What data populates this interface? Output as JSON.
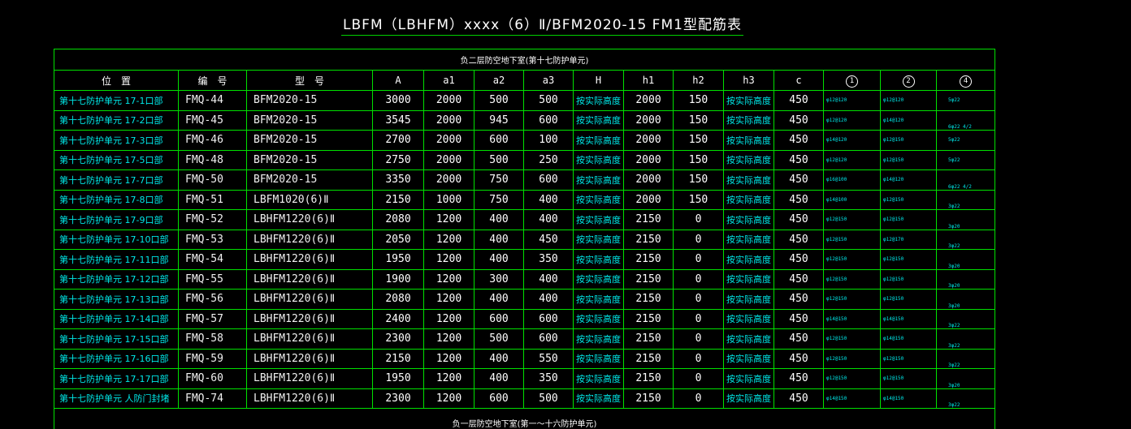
{
  "title": "LBFM（LBHFM）xxxx（6）Ⅱ/BFM2020-15 FM1型配筋表",
  "section_top": "负二层防空地下室(第十七防护单元)",
  "section_bottom": "负一层防空地下室(第一～十六防护单元)",
  "headers": [
    "位　置",
    "编　号",
    "型　号",
    "A",
    "a1",
    "a2",
    "a3",
    "H",
    "h1",
    "h2",
    "h3",
    "c",
    "1",
    "2",
    "4"
  ],
  "rows": [
    {
      "pos": "第十七防护单元 17-1口部",
      "code": "FMQ-44",
      "model": "BFM2020-15",
      "A": "3000",
      "a1": "2000",
      "a2": "500",
      "a3": "500",
      "H": "按实际高度",
      "h1": "2000",
      "h2": "150",
      "h3": "按实际高度",
      "c": "450",
      "r1": "φ12@120",
      "r2": "φ12@120",
      "r4": "5φ22",
      "r4low": false
    },
    {
      "pos": "第十七防护单元 17-2口部",
      "code": "FMQ-45",
      "model": "BFM2020-15",
      "A": "3545",
      "a1": "2000",
      "a2": "945",
      "a3": "600",
      "H": "按实际高度",
      "h1": "2000",
      "h2": "150",
      "h3": "按实际高度",
      "c": "450",
      "r1": "φ12@120",
      "r2": "φ14@120",
      "r4": "6φ22 4/2",
      "r4low": true
    },
    {
      "pos": "第十七防护单元 17-3口部",
      "code": "FMQ-46",
      "model": "BFM2020-15",
      "A": "2700",
      "a1": "2000",
      "a2": "600",
      "a3": "100",
      "H": "按实际高度",
      "h1": "2000",
      "h2": "150",
      "h3": "按实际高度",
      "c": "450",
      "r1": "φ14@120",
      "r2": "φ12@150",
      "r4": "5φ22",
      "r4low": false
    },
    {
      "pos": "第十七防护单元 17-5口部",
      "code": "FMQ-48",
      "model": "BFM2020-15",
      "A": "2750",
      "a1": "2000",
      "a2": "500",
      "a3": "250",
      "H": "按实际高度",
      "h1": "2000",
      "h2": "150",
      "h3": "按实际高度",
      "c": "450",
      "r1": "φ12@120",
      "r2": "φ12@150",
      "r4": "5φ22",
      "r4low": false
    },
    {
      "pos": "第十七防护单元 17-7口部",
      "code": "FMQ-50",
      "model": "BFM2020-15",
      "A": "3350",
      "a1": "2000",
      "a2": "750",
      "a3": "600",
      "H": "按实际高度",
      "h1": "2000",
      "h2": "150",
      "h3": "按实际高度",
      "c": "450",
      "r1": "φ16@100",
      "r2": "φ14@120",
      "r4": "6φ22 4/2",
      "r4low": true
    },
    {
      "pos": "第十七防护单元 17-8口部",
      "code": "FMQ-51",
      "model": "LBFM1020(6)Ⅱ",
      "A": "2150",
      "a1": "1000",
      "a2": "750",
      "a3": "400",
      "H": "按实际高度",
      "h1": "2000",
      "h2": "150",
      "h3": "按实际高度",
      "c": "450",
      "r1": "φ14@100",
      "r2": "φ12@150",
      "r4": "3φ22",
      "r4low": true
    },
    {
      "pos": "第十七防护单元 17-9口部",
      "code": "FMQ-52",
      "model": "LBHFM1220(6)Ⅱ",
      "A": "2080",
      "a1": "1200",
      "a2": "400",
      "a3": "400",
      "H": "按实际高度",
      "h1": "2150",
      "h2": "0",
      "h3": "按实际高度",
      "c": "450",
      "r1": "φ12@150",
      "r2": "φ12@150",
      "r4": "3φ20",
      "r4low": true
    },
    {
      "pos": "第十七防护单元 17-10口部",
      "code": "FMQ-53",
      "model": "LBHFM1220(6)Ⅱ",
      "A": "2050",
      "a1": "1200",
      "a2": "400",
      "a3": "450",
      "H": "按实际高度",
      "h1": "2150",
      "h2": "0",
      "h3": "按实际高度",
      "c": "450",
      "r1": "φ12@150",
      "r2": "φ12@170",
      "r4": "3φ22",
      "r4low": true
    },
    {
      "pos": "第十七防护单元 17-11口部",
      "code": "FMQ-54",
      "model": "LBHFM1220(6)Ⅱ",
      "A": "1950",
      "a1": "1200",
      "a2": "400",
      "a3": "350",
      "H": "按实际高度",
      "h1": "2150",
      "h2": "0",
      "h3": "按实际高度",
      "c": "450",
      "r1": "φ12@150",
      "r2": "φ12@150",
      "r4": "3φ20",
      "r4low": true
    },
    {
      "pos": "第十七防护单元 17-12口部",
      "code": "FMQ-55",
      "model": "LBHFM1220(6)Ⅱ",
      "A": "1900",
      "a1": "1200",
      "a2": "300",
      "a3": "400",
      "H": "按实际高度",
      "h1": "2150",
      "h2": "0",
      "h3": "按实际高度",
      "c": "450",
      "r1": "φ12@150",
      "r2": "φ12@150",
      "r4": "3φ20",
      "r4low": true
    },
    {
      "pos": "第十七防护单元 17-13口部",
      "code": "FMQ-56",
      "model": "LBHFM1220(6)Ⅱ",
      "A": "2080",
      "a1": "1200",
      "a2": "400",
      "a3": "400",
      "H": "按实际高度",
      "h1": "2150",
      "h2": "0",
      "h3": "按实际高度",
      "c": "450",
      "r1": "φ12@150",
      "r2": "φ12@150",
      "r4": "3φ20",
      "r4low": true
    },
    {
      "pos": "第十七防护单元 17-14口部",
      "code": "FMQ-57",
      "model": "LBHFM1220(6)Ⅱ",
      "A": "2400",
      "a1": "1200",
      "a2": "600",
      "a3": "600",
      "H": "按实际高度",
      "h1": "2150",
      "h2": "0",
      "h3": "按实际高度",
      "c": "450",
      "r1": "φ14@150",
      "r2": "φ14@150",
      "r4": "3φ22",
      "r4low": true
    },
    {
      "pos": "第十七防护单元 17-15口部",
      "code": "FMQ-58",
      "model": "LBHFM1220(6)Ⅱ",
      "A": "2300",
      "a1": "1200",
      "a2": "500",
      "a3": "600",
      "H": "按实际高度",
      "h1": "2150",
      "h2": "0",
      "h3": "按实际高度",
      "c": "450",
      "r1": "φ12@150",
      "r2": "φ14@150",
      "r4": "3φ22",
      "r4low": true
    },
    {
      "pos": "第十七防护单元 17-16口部",
      "code": "FMQ-59",
      "model": "LBHFM1220(6)Ⅱ",
      "A": "2150",
      "a1": "1200",
      "a2": "400",
      "a3": "550",
      "H": "按实际高度",
      "h1": "2150",
      "h2": "0",
      "h3": "按实际高度",
      "c": "450",
      "r1": "φ12@150",
      "r2": "φ12@150",
      "r4": "3φ22",
      "r4low": true
    },
    {
      "pos": "第十七防护单元 17-17口部",
      "code": "FMQ-60",
      "model": "LBHFM1220(6)Ⅱ",
      "A": "1950",
      "a1": "1200",
      "a2": "400",
      "a3": "350",
      "H": "按实际高度",
      "h1": "2150",
      "h2": "0",
      "h3": "按实际高度",
      "c": "450",
      "r1": "φ12@150",
      "r2": "φ12@150",
      "r4": "3φ20",
      "r4low": true
    },
    {
      "pos": "第十七防护单元 人防门封堵",
      "code": "FMQ-74",
      "model": "LBHFM1220(6)Ⅱ",
      "A": "2300",
      "a1": "1200",
      "a2": "600",
      "a3": "500",
      "H": "按实际高度",
      "h1": "2150",
      "h2": "0",
      "h3": "按实际高度",
      "c": "450",
      "r1": "φ14@150",
      "r2": "φ14@150",
      "r4": "3φ22",
      "r4low": true
    }
  ],
  "colors": {
    "grid": "#00e000",
    "cyan": "#00e8e8",
    "text": "#ffffff",
    "background": "#000000"
  }
}
